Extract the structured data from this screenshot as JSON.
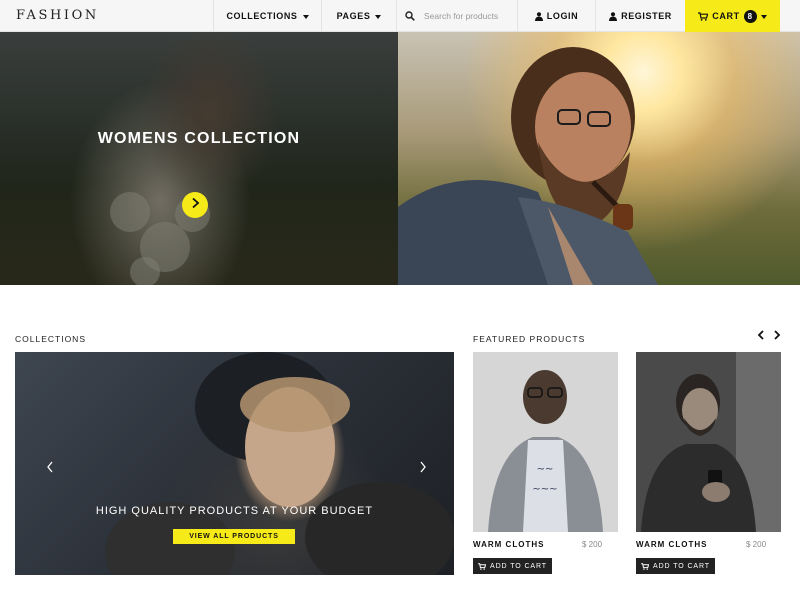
{
  "brand": {
    "logo": "FASHION"
  },
  "nav": {
    "collections_label": "COLLECTIONS",
    "pages_label": "PAGES",
    "search_placeholder": "Search for products",
    "login_label": "LOGIN",
    "register_label": "REGISTER",
    "cart_label": "CART",
    "cart_count": "8"
  },
  "hero": {
    "left_title": "WOMENS COLLECTION"
  },
  "sections": {
    "collections_title": "COLLECTIONS",
    "featured_title": "FEATURED PRODUCTS"
  },
  "collection_banner": {
    "title": "HIGH QUALITY PRODUCTS AT YOUR BUDGET",
    "button_label": "VIEW ALL PRODUCTS"
  },
  "products": [
    {
      "name": "WARM CLOTHS",
      "price": "$ 200",
      "button_label": "ADD TO CART"
    },
    {
      "name": "WARM CLOTHS",
      "price": "$ 200",
      "button_label": "ADD TO CART"
    }
  ],
  "colors": {
    "accent": "#f7ea19",
    "dark": "#222222",
    "nav_bg": "#f6f6f6"
  },
  "icons": {
    "login": "user-icon",
    "register": "user-icon",
    "cart": "cart-icon",
    "search": "search-icon"
  }
}
